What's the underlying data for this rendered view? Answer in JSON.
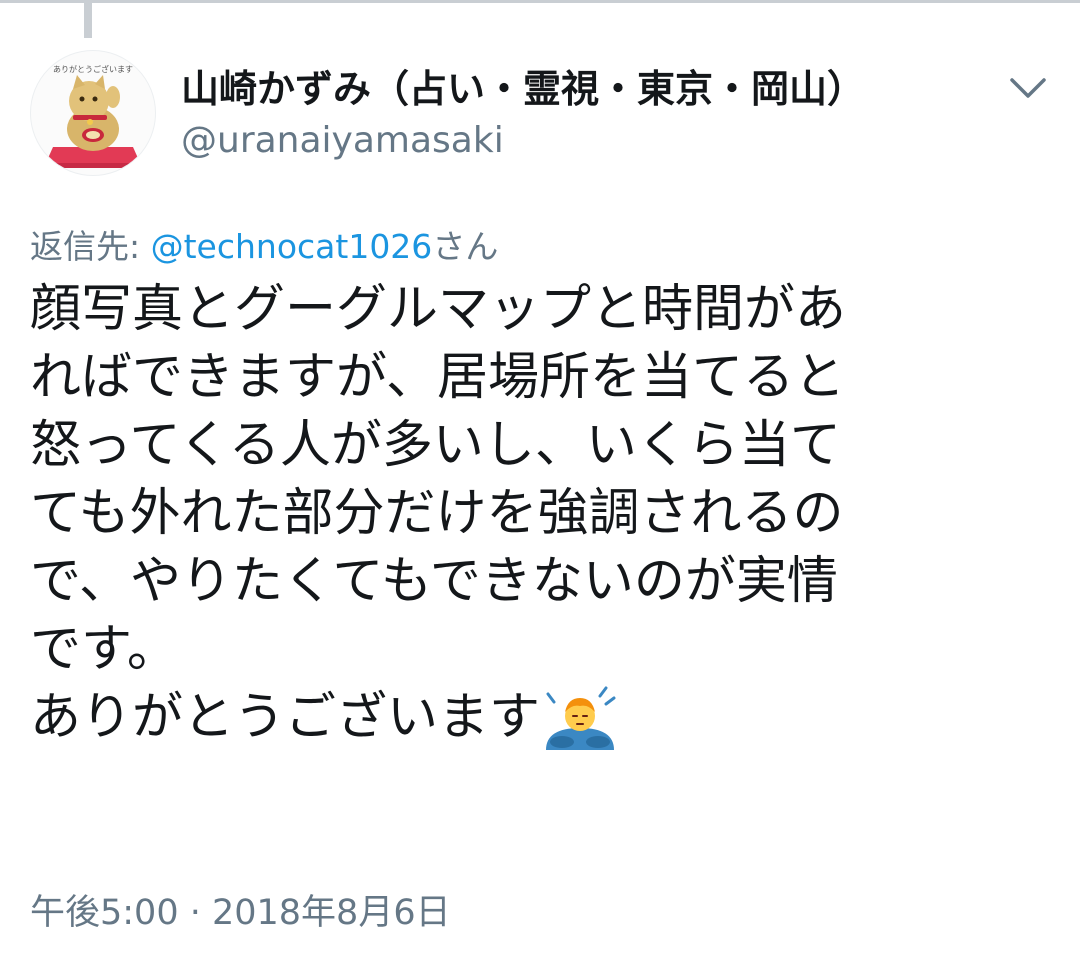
{
  "tweet": {
    "display_name": "山崎かずみ（占い・霊視・東京・岡山）",
    "handle": "@uranaiyamasaki",
    "avatar_caption": "ありがとうございます",
    "avatar_icon": "maneki-neko-image",
    "menu_icon": "chevron-down-icon",
    "reply_prefix": "返信先: ",
    "reply_mention": "@technocat1026",
    "reply_suffix": "さん",
    "body_lines": [
      "顔写真とグーグルマップと時間があ",
      "ればできますが、居場所を当てると",
      "怒ってくる人が多いし、いくら当て",
      "ても外れた部分だけを強調されるの",
      "で、やりたくてもできないのが実情",
      "です。",
      "ありがとうございます"
    ],
    "emoji": "man-bowing-emoji",
    "timestamp": "午後5:00 · 2018年8月6日"
  },
  "colors": {
    "text_primary": "#14171a",
    "text_secondary": "#657786",
    "link": "#1b95e0",
    "border": "#c9ced3"
  }
}
